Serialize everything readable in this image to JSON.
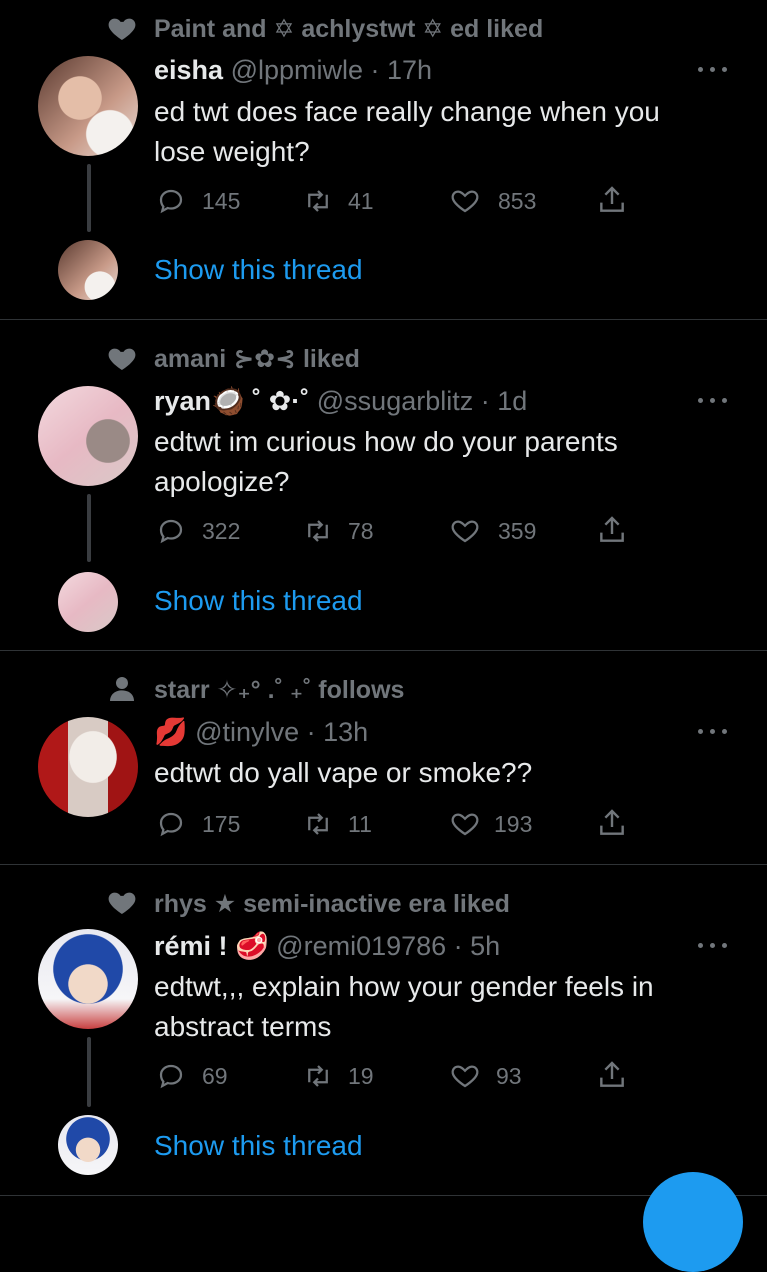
{
  "colors": {
    "background": "#000000",
    "text": "#e7e9ea",
    "muted": "#71767b",
    "accent": "#1d9bf0",
    "separator": "#2f3336"
  },
  "tweets": [
    {
      "context_icon": "heart-icon",
      "context": "Paint and ✡ achlystwt ✡ ed liked",
      "name": "eisha",
      "handle": "@lppmiwle · 17h",
      "text": "ed twt does face really change when you lose weight?",
      "replies": "145",
      "retweets": "41",
      "likes": "853",
      "show_thread": "Show this thread"
    },
    {
      "context_icon": "heart-icon",
      "context": "amani ⊱✿⊰ liked",
      "name": "ryan🥥 ˚ ✿·˚",
      "handle": "@ssugarblitz · 1d",
      "text": "edtwt im curious how do your parents apologize?",
      "replies": "322",
      "retweets": "78",
      "likes": "359",
      "show_thread": "Show this thread"
    },
    {
      "context_icon": "person-icon",
      "context": "starr ✧₊° .˚ ₊˚ follows",
      "name": "💋",
      "handle": "@tinylve · 13h",
      "text": "edtwt do yall vape or smoke??",
      "replies": "175",
      "retweets": "11",
      "likes": "193"
    },
    {
      "context_icon": "heart-icon",
      "context": "rhys ★ semi-inactive era liked",
      "name": "rémi ! 🥩",
      "handle": "@remi019786 · 5h",
      "text": "edtwt,,, explain how your gender feels in abstract terms",
      "replies": "69",
      "retweets": "19",
      "likes": "93",
      "show_thread": "Show this thread"
    }
  ]
}
